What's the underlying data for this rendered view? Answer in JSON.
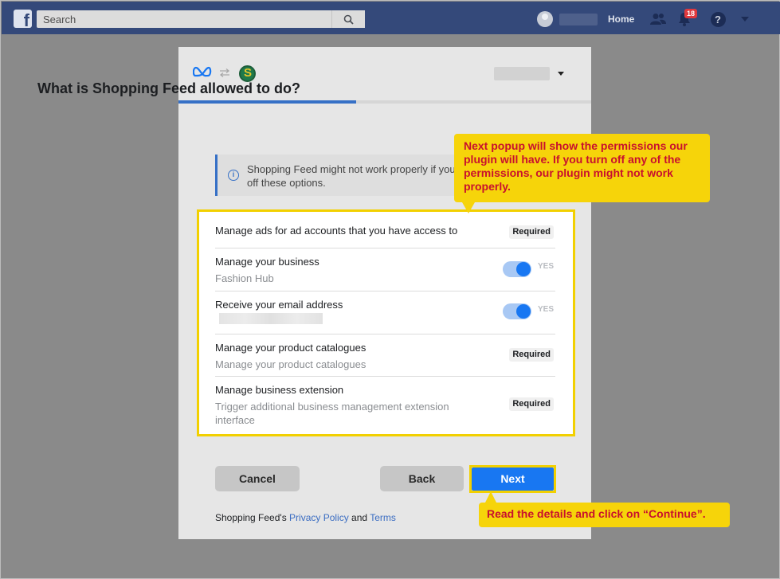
{
  "topbar": {
    "search_placeholder": "Search",
    "home_label": "Home",
    "notification_count": "18",
    "help_label": "?"
  },
  "dialog": {
    "title": "What is Shopping Feed allowed to do?",
    "info_text": "Shopping Feed might not work properly if you turn off these options.",
    "progress_percent": 43,
    "permissions": [
      {
        "title": "Manage ads for ad accounts that you have access to",
        "subtitle": "",
        "status": "Required"
      },
      {
        "title": "Manage your business",
        "subtitle": "Fashion Hub",
        "status": "YES"
      },
      {
        "title": "Receive your email address",
        "subtitle": "",
        "status": "YES"
      },
      {
        "title": "Manage your product catalogues",
        "subtitle": "Manage your product catalogues",
        "status": "Required"
      },
      {
        "title": "Manage business extension",
        "subtitle": "Trigger additional business management extension interface",
        "status": "Required"
      }
    ],
    "buttons": {
      "cancel": "Cancel",
      "back": "Back",
      "next": "Next"
    },
    "footer": {
      "prefix": "Shopping Feed's ",
      "privacy": "Privacy Policy",
      "and": " and ",
      "terms": "Terms"
    }
  },
  "callouts": {
    "top": "Next popup will show the permissions our plugin will have. If you turn off any of the permissions, our plugin might not work properly.",
    "bottom": "Read the details and click on “Continue”."
  },
  "colors": {
    "topbar": "#34497a",
    "accent": "#1877f2",
    "highlight": "#f2d000",
    "callout_text": "#c8102e"
  }
}
